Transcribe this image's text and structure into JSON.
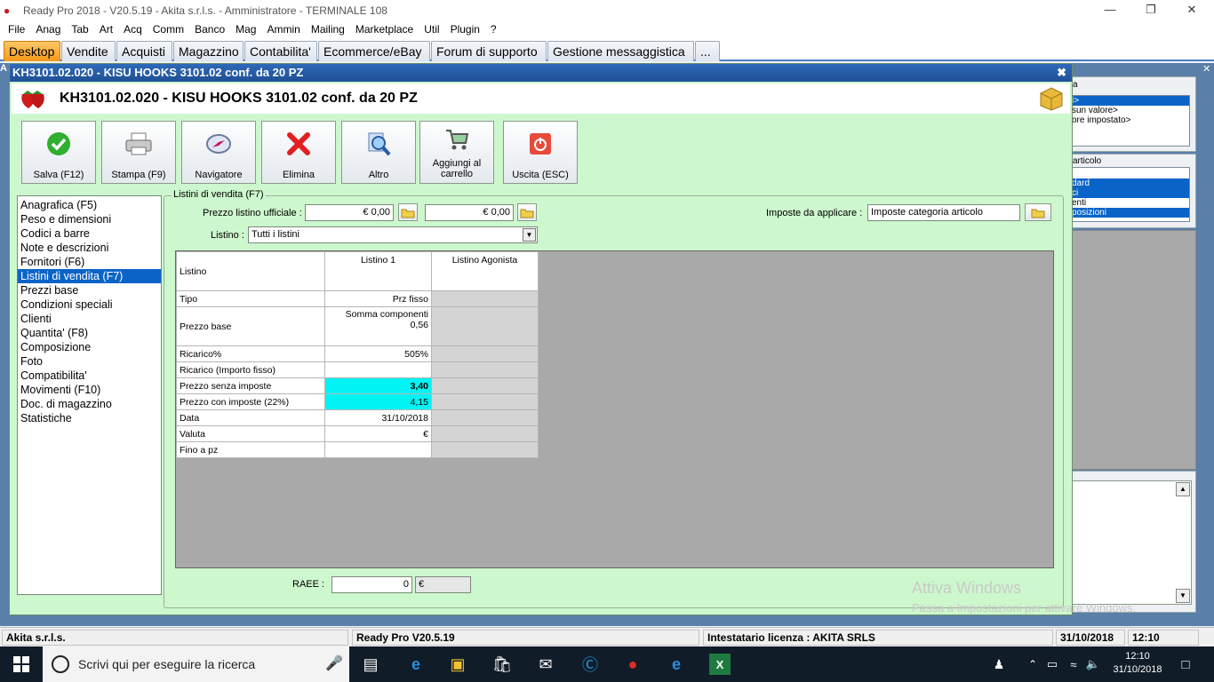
{
  "titlebar": {
    "title": "Ready Pro 2018 - V20.5.19 - Akita s.r.l.s. - Amministratore - TERMINALE 108"
  },
  "menu": [
    "File",
    "Anag",
    "Tab",
    "Art",
    "Acq",
    "Comm",
    "Banco",
    "Mag",
    "Ammin",
    "Mailing",
    "Marketplace",
    "Util",
    "Plugin",
    "?"
  ],
  "tabs": [
    "Desktop",
    "Vendite",
    "Acquisti",
    "Magazzino",
    "Contabilita'",
    "Ecommerce/eBay",
    "Forum di supporto",
    "Gestione messaggistica",
    "..."
  ],
  "active_tab": "Desktop",
  "window": {
    "caption": "KH3101.02.020 - KISU HOOKS 3101.02 conf. da 20 PZ",
    "header_title": "KH3101.02.020 - KISU HOOKS 3101.02 conf. da 20 PZ"
  },
  "toolbar": {
    "save": "Salva (F12)",
    "print": "Stampa (F9)",
    "navigator": "Navigatore",
    "delete": "Elimina",
    "other": "Altro",
    "cart_line1": "Aggiungi al",
    "cart_line2": "carrello",
    "exit": "Uscita (ESC)"
  },
  "nav_items": [
    "Anagrafica (F5)",
    "Peso e dimensioni",
    "Codici a barre",
    "Note e descrizioni",
    "Fornitori (F6)",
    "Listini di vendita (F7)",
    "Prezzi base",
    "Condizioni speciali",
    "Clienti",
    "Quantita' (F8)",
    "Composizione",
    "Foto",
    "Compatibilita'",
    "Movimenti (F10)",
    "Doc. di magazzino",
    "Statistiche"
  ],
  "nav_selected_index": 5,
  "group": {
    "legend": "Listini di vendita (F7)",
    "official_price_label": "Prezzo listino ufficiale :",
    "official_price_1": "€ 0,00",
    "official_price_2": "€ 0,00",
    "taxes_label": "Imposte da applicare :",
    "taxes_value": "Imposte categoria articolo",
    "listino_label": "Listino :",
    "listino_value": "Tutti i listini",
    "raee_label": "RAEE :",
    "raee_value": "0",
    "raee_currency": "€"
  },
  "grid": {
    "corner": "Listino",
    "col1": "Listino 1",
    "col2": "Listino Agonista",
    "rows": [
      {
        "label": "Tipo",
        "v1": "Prz fisso"
      },
      {
        "label": "Prezzo base",
        "v1a": "Somma componenti",
        "v1b": "0,56"
      },
      {
        "label": "Ricarico%",
        "v1": "505%"
      },
      {
        "label": "Ricarico (Importo fisso)",
        "v1": ""
      },
      {
        "label": "Prezzo senza imposte",
        "v1": "3,40"
      },
      {
        "label": "Prezzo con imposte (22%)",
        "v1": "4,15"
      },
      {
        "label": "Data",
        "v1": "31/10/2018"
      },
      {
        "label": "Valuta",
        "v1": "€"
      },
      {
        "label": "Fino a pz",
        "v1": ""
      }
    ]
  },
  "right_panel": {
    "list1": [
      "i>",
      "sun valore>",
      "ore impostato>"
    ],
    "list1_header": "a",
    "list2_header": "articolo",
    "list2": [
      "dard",
      "ci",
      "enti",
      "posizioni"
    ]
  },
  "watermark": {
    "line1": "Attiva Windows",
    "line2": "Passa a Impostazioni per attivare Windows."
  },
  "status": {
    "company": "Akita s.r.l.s.",
    "version": "Ready Pro V20.5.19",
    "license": "Intestatario licenza : AKITA SRLS",
    "date": "31/10/2018",
    "time": "12:10"
  },
  "taskbar": {
    "search_placeholder": "Scrivi qui per eseguire la ricerca",
    "time": "12:10",
    "date": "31/10/2018"
  },
  "colors": {
    "accent": "#0a64c8",
    "window_bg": "#cdf7cd",
    "highlight_cell": "#00f4f4",
    "active_tab": "#f59a1b"
  }
}
